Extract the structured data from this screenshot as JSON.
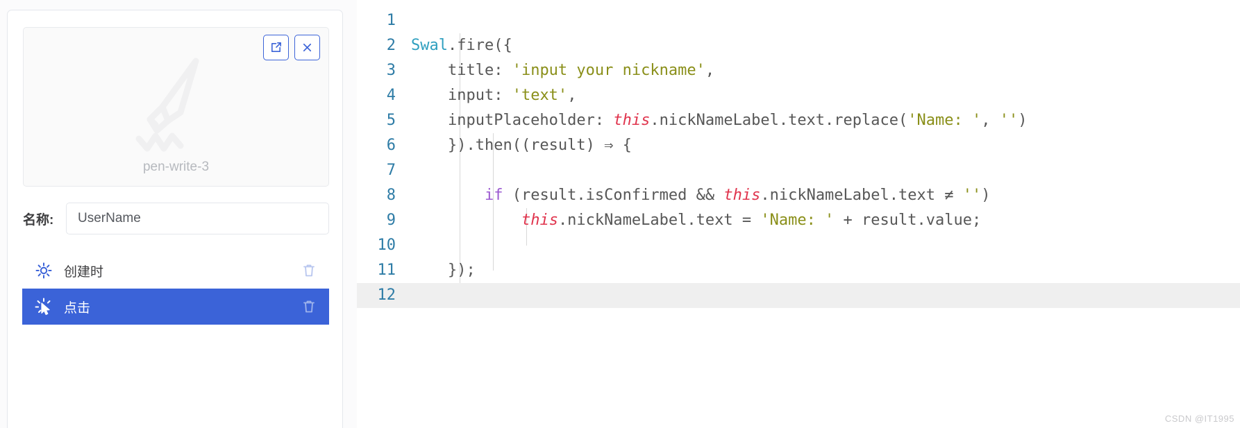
{
  "left_panel": {
    "preview": {
      "caption": "pen-write-3",
      "icon_name": "pen-write-illustration",
      "actions": [
        {
          "name": "open-external-button",
          "icon": "external-link-icon"
        },
        {
          "name": "close-button",
          "icon": "close-icon"
        }
      ]
    },
    "name_field": {
      "label": "名称:",
      "value": "UserName",
      "placeholder": "UserName"
    },
    "events": [
      {
        "label": "创建时",
        "icon": "sun-create-icon",
        "selected": false,
        "delete_icon": "trash-icon"
      },
      {
        "label": "点击",
        "icon": "click-cursor-icon",
        "selected": true,
        "delete_icon": "trash-icon"
      }
    ]
  },
  "editor": {
    "current_line": 12,
    "lines": [
      {
        "n": "1",
        "code": ""
      },
      {
        "n": "2",
        "code": "Swal.fire({"
      },
      {
        "n": "3",
        "code": "    title: 'input your nickname',"
      },
      {
        "n": "4",
        "code": "    input: 'text',"
      },
      {
        "n": "5",
        "code": "    inputPlaceholder: this.nickNameLabel.text.replace('Name: ', '')"
      },
      {
        "n": "6",
        "code": "    }).then((result) ⇒ {"
      },
      {
        "n": "7",
        "code": ""
      },
      {
        "n": "8",
        "code": "        if (result.isConfirmed && this.nickNameLabel.text ≠ '')"
      },
      {
        "n": "9",
        "code": "            this.nickNameLabel.text = 'Name: ' + result.value;"
      },
      {
        "n": "10",
        "code": ""
      },
      {
        "n": "11",
        "code": "    });"
      },
      {
        "n": "12",
        "code": ""
      }
    ]
  },
  "watermark": "CSDN @IT1995",
  "colors": {
    "accent": "#3b63d8",
    "selected_row": "#3b63d8",
    "string": "#8a8f19",
    "class": "#2e9fbf",
    "keyword": "#9b59d0",
    "this": "#e0344d",
    "line_number": "#2e7ca6",
    "current_line_bg": "#efefef"
  }
}
